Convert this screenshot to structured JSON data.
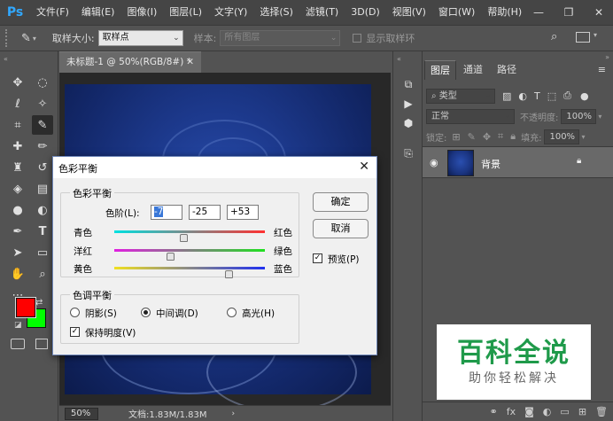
{
  "app": {
    "logo": "Ps"
  },
  "menu": [
    "文件(F)",
    "编辑(E)",
    "图像(I)",
    "图层(L)",
    "文字(Y)",
    "选择(S)",
    "滤镜(T)",
    "3D(D)",
    "视图(V)",
    "窗口(W)",
    "帮助(H)"
  ],
  "window_controls": {
    "minimize": "—",
    "restore": "❐",
    "close": "✕"
  },
  "options_bar": {
    "sample_size_label": "取样大小:",
    "sample_size_value": "取样点",
    "sample_label": "样本:",
    "sample_value": "所有图层",
    "show_ring_label": "显示取样环"
  },
  "document": {
    "tab_title": "未标题-1 @ 50%(RGB/8#) *",
    "zoom": "50%",
    "doc_info": "文档:1.83M/1.83M"
  },
  "layers_panel": {
    "tabs": [
      "图层",
      "通道",
      "路径"
    ],
    "filter_kind": "类型",
    "blend_mode": "正常",
    "opacity_label": "不透明度:",
    "opacity_value": "100%",
    "lock_label": "锁定:",
    "fill_label": "填充:",
    "fill_value": "100%",
    "layer_name": "背景"
  },
  "dialog": {
    "title": "色彩平衡",
    "color_balance_group": "色彩平衡",
    "levels_label": "色阶(L):",
    "levels": [
      "-7",
      "-25",
      "+53"
    ],
    "sliders": [
      {
        "left": "青色",
        "right": "红色",
        "value": -7
      },
      {
        "left": "洋红",
        "right": "绿色",
        "value": -25
      },
      {
        "left": "黄色",
        "right": "蓝色",
        "value": 53
      }
    ],
    "tone_balance_group": "色调平衡",
    "tones": [
      {
        "label": "阴影(S)",
        "selected": false
      },
      {
        "label": "中间调(D)",
        "selected": true
      },
      {
        "label": "高光(H)",
        "selected": false
      }
    ],
    "preserve_luminosity_label": "保持明度(V)",
    "preserve_luminosity": true,
    "ok_label": "确定",
    "cancel_label": "取消",
    "preview_label": "预览(P)",
    "preview": true
  },
  "colors": {
    "foreground": "#ff0000",
    "background": "#00ff00",
    "accent": "#31a8ff",
    "watermark_green": "#1f9a4a"
  },
  "watermark": {
    "title": "百科全说",
    "subtitle": "助你轻松解决"
  }
}
